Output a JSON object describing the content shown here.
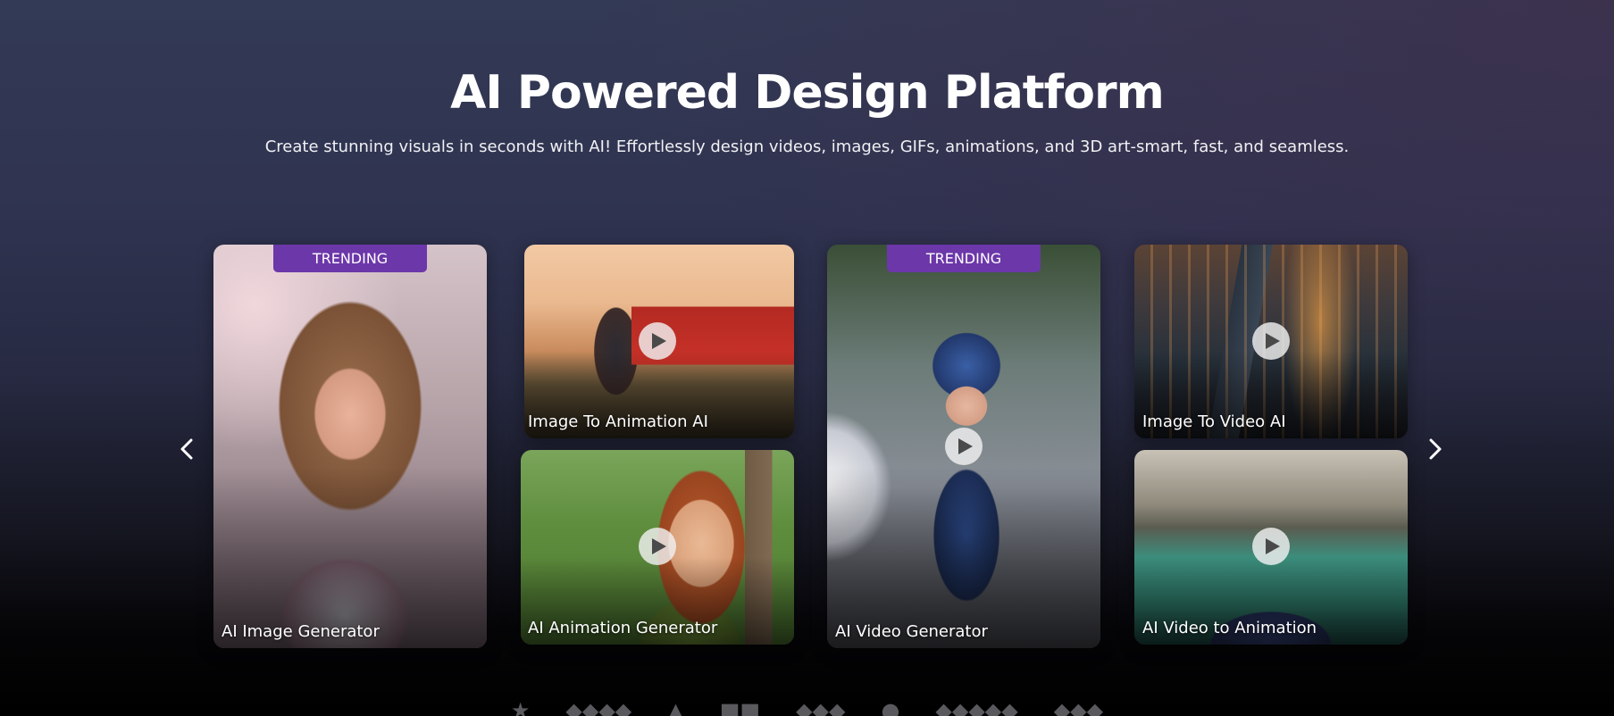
{
  "hero": {
    "title": "AI Powered Design Platform",
    "subtitle": "Create stunning visuals in seconds with AI! Effortlessly design videos, images, GIFs, animations, and 3D art-smart, fast, and seamless."
  },
  "carousel": {
    "prev_icon": "chevron-left-icon",
    "next_icon": "chevron-right-icon",
    "cards": [
      {
        "label": "AI Image Generator",
        "badge": "TRENDING"
      },
      {
        "label": "Image To Animation AI"
      },
      {
        "label": "AI Animation Generator"
      },
      {
        "label": "AI Video Generator",
        "badge": "TRENDING"
      },
      {
        "label": "Image To Video AI"
      },
      {
        "label": "AI Video to Animation"
      }
    ]
  },
  "colors": {
    "badge": "#6c37a9",
    "background_top": "#333a55",
    "background_bottom": "#000000"
  }
}
